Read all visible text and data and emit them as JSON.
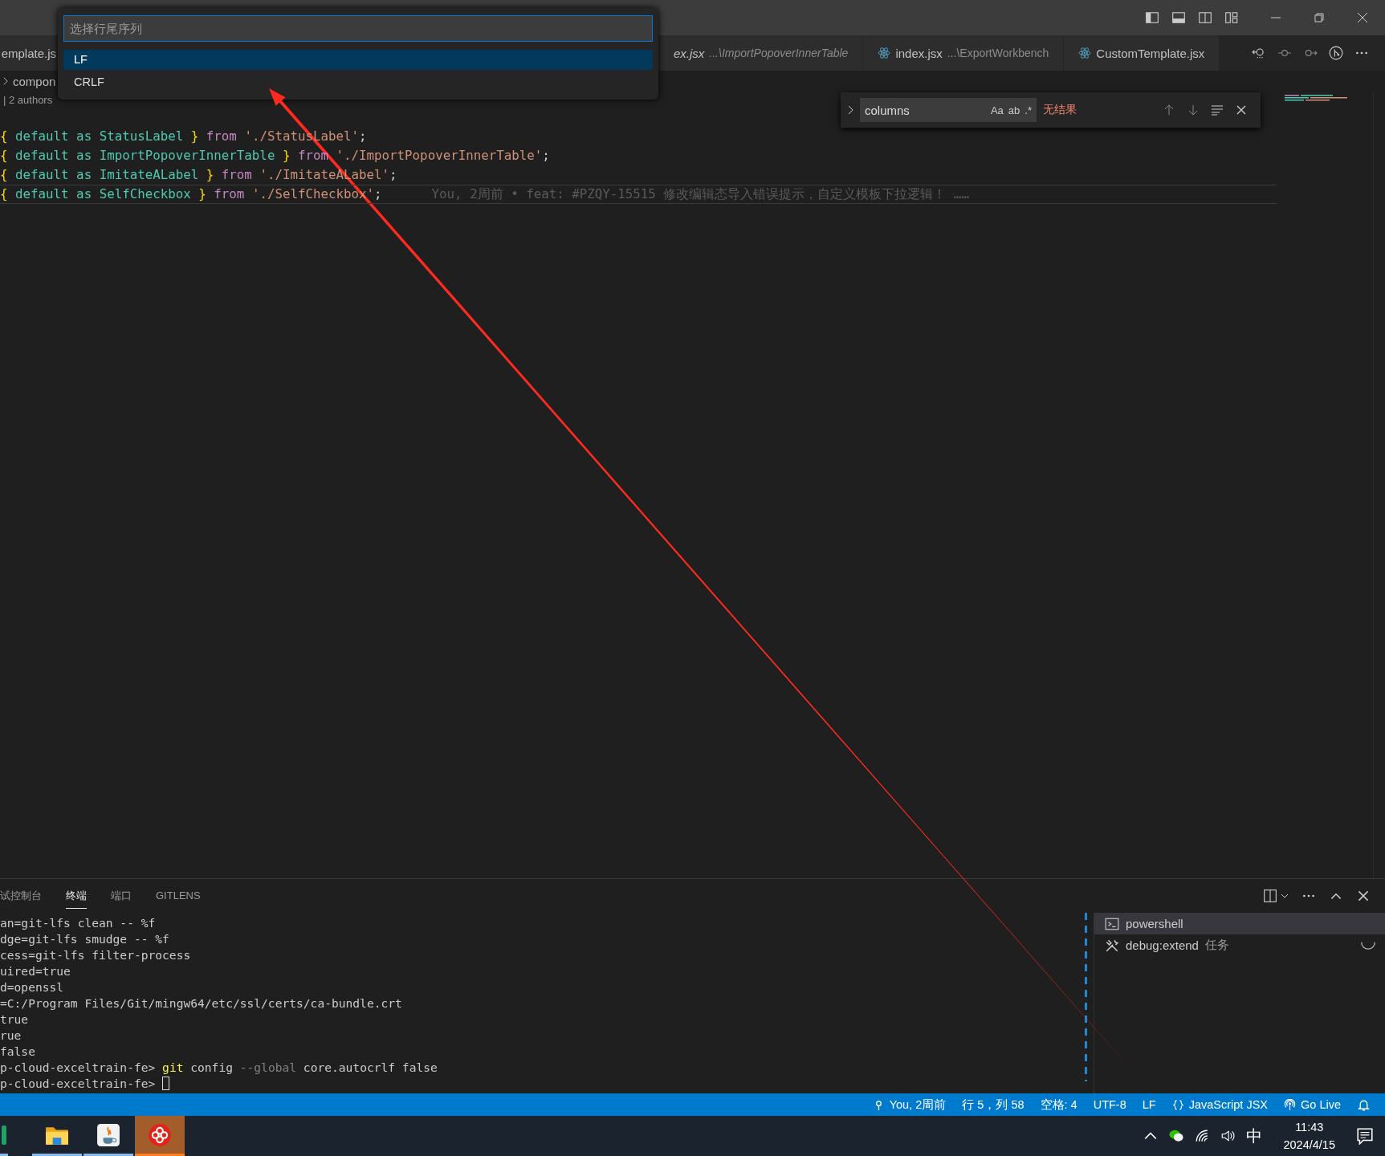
{
  "quick_pick": {
    "placeholder": "选择行尾序列",
    "items": [
      {
        "label": "LF",
        "selected": true
      },
      {
        "label": "CRLF",
        "selected": false
      }
    ]
  },
  "tabs": [
    {
      "name": "emplate.js",
      "preview": false,
      "selected": false
    },
    {
      "name": "ex.jsx",
      "path": "...\\ImportPopoverInnerTable",
      "preview": true,
      "selected": false
    },
    {
      "name": "index.jsx",
      "path": "...\\ExportWorkbench",
      "preview": false,
      "selected": false
    },
    {
      "name": "CustomTemplate.jsx",
      "preview": false,
      "selected": false
    }
  ],
  "breadcrumb": "compon",
  "codelens": "| 2 authors",
  "find": {
    "value": "columns",
    "options": [
      "Aa",
      "ab",
      ".*"
    ],
    "result": "无结果"
  },
  "code": {
    "lines": [
      {
        "current": false,
        "tokens": [
          {
            "text": "{ ",
            "kind": "brace"
          },
          {
            "text": "default as StatusLabel ",
            "kind": "name"
          },
          {
            "text": "} ",
            "kind": "brace"
          },
          {
            "text": "from ",
            "kind": "control"
          },
          {
            "text": "'./StatusLabel'",
            "kind": "string"
          },
          {
            "text": ";",
            "kind": "plain"
          }
        ]
      },
      {
        "current": false,
        "tokens": [
          {
            "text": "{ ",
            "kind": "brace"
          },
          {
            "text": "default as ImportPopoverInnerTable ",
            "kind": "name"
          },
          {
            "text": "} ",
            "kind": "brace"
          },
          {
            "text": "from ",
            "kind": "control"
          },
          {
            "text": "'./ImportPopoverInnerTable'",
            "kind": "string"
          },
          {
            "text": ";",
            "kind": "plain"
          }
        ]
      },
      {
        "current": false,
        "tokens": [
          {
            "text": "{ ",
            "kind": "brace"
          },
          {
            "text": "default as ImitateALabel ",
            "kind": "name"
          },
          {
            "text": "} ",
            "kind": "brace"
          },
          {
            "text": "from ",
            "kind": "control"
          },
          {
            "text": "'./ImitateALabel'",
            "kind": "string"
          },
          {
            "text": ";",
            "kind": "plain"
          }
        ]
      },
      {
        "current": true,
        "tokens": [
          {
            "text": "{ ",
            "kind": "brace"
          },
          {
            "text": "default as SelfCheckbox ",
            "kind": "name"
          },
          {
            "text": "} ",
            "kind": "brace"
          },
          {
            "text": "from ",
            "kind": "control"
          },
          {
            "text": "'./SelfCheckbox'",
            "kind": "string"
          },
          {
            "text": ";",
            "kind": "plain"
          }
        ],
        "blame": "You, 2周前 • feat: #PZQY-15515 修改编辑态导入错误提示，自定义模板下拉逻辑！ ……"
      }
    ]
  },
  "panel_tabs": [
    {
      "label": "试控制台",
      "selected": false
    },
    {
      "label": "终端",
      "selected": true
    },
    {
      "label": "端口",
      "selected": false
    },
    {
      "label": "GITLENS",
      "selected": false
    }
  ],
  "terminal": [
    {
      "kind": "output",
      "text": "an=git-lfs clean -- %f"
    },
    {
      "kind": "output",
      "text": "dge=git-lfs smudge -- %f"
    },
    {
      "kind": "output",
      "text": "cess=git-lfs filter-process"
    },
    {
      "kind": "output",
      "text": "uired=true"
    },
    {
      "kind": "output",
      "text": "d=openssl"
    },
    {
      "kind": "output",
      "text": "=C:/Program Files/Git/mingw64/etc/ssl/certs/ca-bundle.crt"
    },
    {
      "kind": "output",
      "text": "true"
    },
    {
      "kind": "output",
      "text": "rue"
    },
    {
      "kind": "output",
      "text": "false"
    },
    {
      "kind": "prompt",
      "prompt": "p-cloud-exceltrain-fe>",
      "command": [
        {
          "text": "git",
          "kind": "exe"
        },
        {
          "text": "config",
          "kind": "arg"
        },
        {
          "text": "--global",
          "kind": "flag"
        },
        {
          "text": "core.autocrlf false",
          "kind": "arg"
        }
      ],
      "cursor": false
    },
    {
      "kind": "prompt",
      "prompt": "p-cloud-exceltrain-fe>",
      "cursor": true
    }
  ],
  "terminals": [
    {
      "kind": "shell",
      "name": "powershell",
      "selected": true
    },
    {
      "kind": "task",
      "name": "debug:extend",
      "note": "任务",
      "selected": false
    }
  ],
  "status_bar": [
    {
      "kind": "blame",
      "text": "You, 2周前"
    },
    {
      "kind": "text",
      "text": "行 5，列 58"
    },
    {
      "kind": "text",
      "text": "空格: 4"
    },
    {
      "kind": "text",
      "text": "UTF-8"
    },
    {
      "kind": "text",
      "text": "LF"
    },
    {
      "kind": "language",
      "text": "JavaScript JSX"
    },
    {
      "kind": "live",
      "text": "Go Live"
    },
    {
      "kind": "bell"
    }
  ],
  "taskbar": {
    "apps": [
      {
        "kind": "sheet",
        "selected": false
      },
      {
        "kind": "folder",
        "selected": false
      },
      {
        "kind": "java",
        "selected": false
      },
      {
        "kind": "flower",
        "selected": true
      }
    ],
    "ime": "中",
    "time": "11:43",
    "date": "2024/4/15"
  }
}
